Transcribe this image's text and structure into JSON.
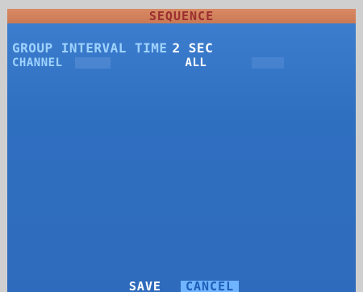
{
  "window": {
    "title": "SEQUENCE"
  },
  "fields": {
    "group_interval_time": {
      "label": "GROUP INTERVAL TIME",
      "value": "2 SEC"
    },
    "channel": {
      "label": "CHANNEL",
      "value": "ALL"
    }
  },
  "buttons": {
    "save": "SAVE",
    "cancel": "CANCEL",
    "selected": "cancel"
  },
  "colors": {
    "background": "#2f6bbd",
    "title_bar": "#d98a64",
    "title_text": "#9b2f2f",
    "label_text": "#9fd3ff",
    "value_text": "#ffffff",
    "selected_button_bg": "#6fb4ff"
  }
}
